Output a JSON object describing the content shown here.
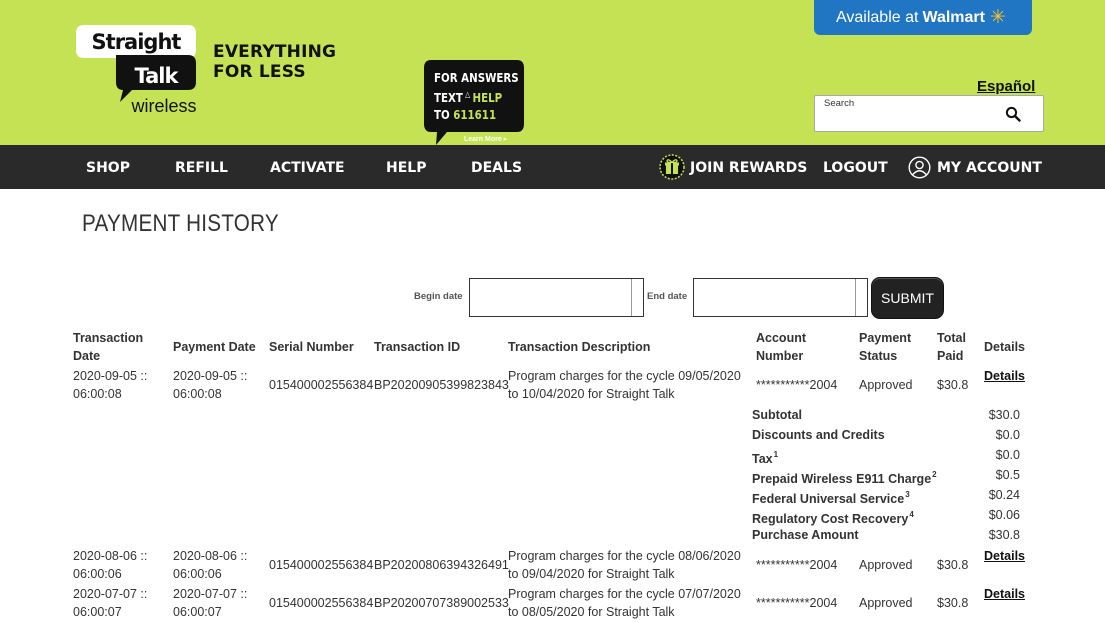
{
  "brand": {
    "logo_line1": "Straight",
    "logo_line2": "Talk",
    "logo_line3": "wireless",
    "tagline_line1": "EVERYTHING",
    "tagline_line2": "FOR LESS"
  },
  "promo": {
    "line1": "FOR ANSWERS",
    "line2_white": "TEXT",
    "line2_green": "HELP",
    "line3_white": "TO",
    "line3_green": "611611",
    "learn_more": "Learn More ▸"
  },
  "walmart": {
    "prefix": "Available at",
    "brand": "Walmart"
  },
  "espanol": "Español",
  "search": {
    "label": "Search",
    "value": "",
    "icon": "search-icon"
  },
  "nav": {
    "shop": "SHOP",
    "refill": "REFILL",
    "activate": "ACTIVATE",
    "help": "HELP",
    "deals": "DEALS",
    "join_rewards": "JOIN REWARDS",
    "logout": "LOGOUT",
    "my_account": "MY ACCOUNT"
  },
  "page": {
    "title": "PAYMENT HISTORY"
  },
  "filters": {
    "begin_label": "Begin date",
    "begin_value": "",
    "end_label": "End date",
    "end_value": "",
    "submit": "SUBMIT"
  },
  "table": {
    "headers": {
      "transaction_date_1": "Transaction",
      "transaction_date_2": "Date",
      "payment_date": "Payment Date",
      "serial_number": "Serial Number",
      "transaction_id": "Transaction ID",
      "description": "Transaction Description",
      "account_1": "Account",
      "account_2": "Number",
      "status_1": "Payment",
      "status_2": "Status",
      "total_1": "Total",
      "total_2": "Paid",
      "details": "Details"
    },
    "rows": [
      {
        "tdate_1": "2020-09-05 ::",
        "tdate_2": "06:00:08",
        "pdate_1": "2020-09-05 ::",
        "pdate_2": "06:00:08",
        "serial": "015400002556384",
        "txn_id": "BP20200905399823843",
        "desc_1": "Program charges for the cycle 09/05/2020",
        "desc_2": "to 10/04/2020 for Straight Talk",
        "account": "***********2004",
        "status": "Approved",
        "total": "$30.8",
        "details": "Details"
      },
      {
        "tdate_1": "2020-08-06 ::",
        "tdate_2": "06:00:06",
        "pdate_1": "2020-08-06 ::",
        "pdate_2": "06:00:06",
        "serial": "015400002556384",
        "txn_id": "BP20200806394326491",
        "desc_1": "Program charges for the cycle 08/06/2020",
        "desc_2": "to 09/04/2020 for Straight Talk",
        "account": "***********2004",
        "status": "Approved",
        "total": "$30.8",
        "details": "Details"
      },
      {
        "tdate_1": "2020-07-07 ::",
        "tdate_2": "06:00:07",
        "pdate_1": "2020-07-07 ::",
        "pdate_2": "06:00:07",
        "serial": "015400002556384",
        "txn_id": "BP20200707389002533",
        "desc_1": "Program charges for the cycle 07/07/2020",
        "desc_2": "to 08/05/2020 for Straight Talk",
        "account": "***********2004",
        "status": "Approved",
        "total": "$30.8",
        "details": "Details"
      }
    ],
    "summary": [
      {
        "label": "Subtotal",
        "sup": "",
        "value": "$30.0"
      },
      {
        "label": "Discounts and Credits",
        "sup": "",
        "value": "$0.0"
      },
      {
        "label": "Tax",
        "sup": "1",
        "value": "$0.0"
      },
      {
        "label": "Prepaid Wireless E911 Charge",
        "sup": "2",
        "value": "$0.5"
      },
      {
        "label": "Federal Universal Service",
        "sup": "3",
        "value": "$0.24"
      },
      {
        "label": "Regulatory Cost Recovery",
        "sup": "4",
        "value": "$0.06"
      },
      {
        "label": "Purchase Amount",
        "sup": "",
        "value": "$30.8"
      }
    ]
  },
  "colors": {
    "header_green": "#c5e254",
    "nav_dark": "#2a2a2a",
    "walmart_blue": "#2176c4",
    "walmart_spark": "#ffc220"
  }
}
